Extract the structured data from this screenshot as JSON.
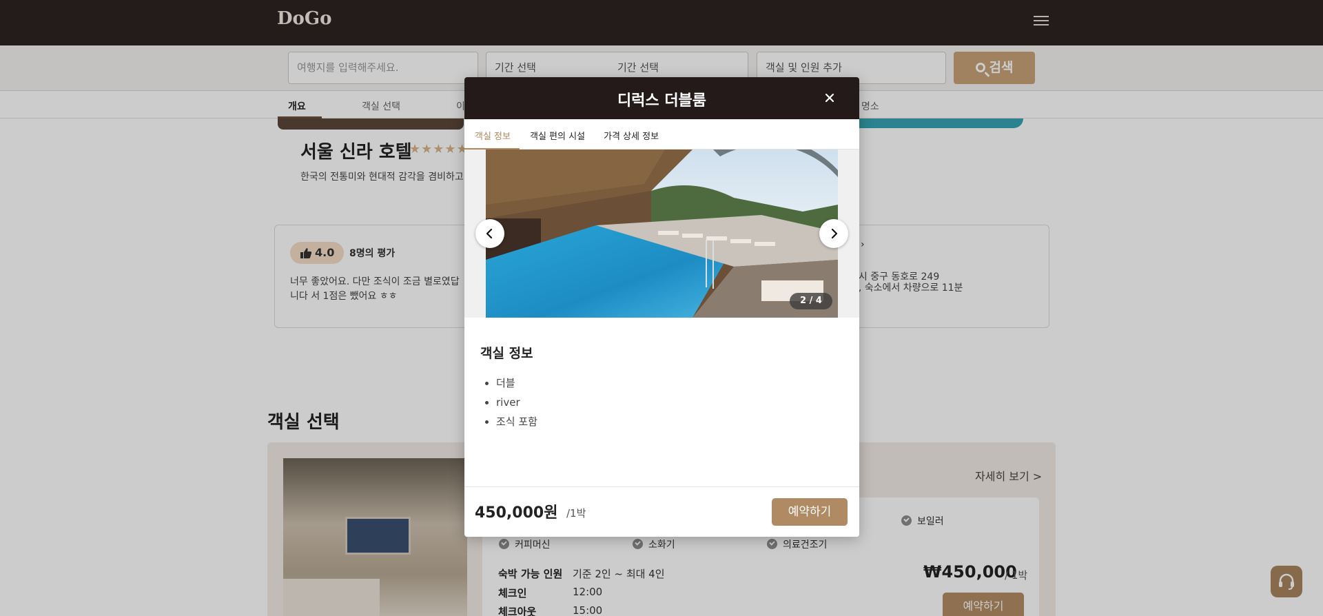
{
  "header": {
    "logo": "DoGo"
  },
  "search": {
    "destination_placeholder": "여행지를 입력해주세요.",
    "start_date": "기간 선택",
    "end_date": "기간 선택",
    "guests": "객실 및 인원 추가",
    "button_label": "검색"
  },
  "page_tabs": [
    {
      "label": "개요",
      "active": true
    },
    {
      "label": "객실 선택",
      "active": false
    },
    {
      "label": "이",
      "active": false
    },
    {
      "label": "명소",
      "active": false
    }
  ],
  "hotel": {
    "name": "서울 신라 호텔",
    "stars": "★★★★★",
    "description": "한국의 전통미와 현대적 감각을 겸비하고"
  },
  "review": {
    "score": "4.0",
    "count_label": "8명의 평가",
    "text": "너무 좋았어요. 다만 조식이 조금 별로였답니다 서 1점은 뺐어요 ㅎㅎ"
  },
  "location": {
    "title_fragment": "›",
    "address_fragment": "별시 중구 동호로 249",
    "distance_fragment": "항, 숙소에서 차량으로 11분"
  },
  "room_section": {
    "title": "객실 선택",
    "detail_link": "자세히 보기 >",
    "amenities": [
      "보일러",
      "커피머신",
      "소화기",
      "의료건조기"
    ],
    "capacity_label": "숙박 가능 인원",
    "capacity_value": "기준 2인 ~ 최대 4인",
    "checkin_label": "체크인",
    "checkin_value": "12:00",
    "checkout_label": "체크아웃",
    "checkout_value": "15:00",
    "price": "₩450,000",
    "price_unit": "/ 1박",
    "book_label": "예약하기"
  },
  "modal": {
    "title": "디럭스 더블룸",
    "close_icon": "close-icon",
    "tabs": [
      {
        "label": "객실 정보",
        "active": true
      },
      {
        "label": "객실 편의 시설",
        "active": false
      },
      {
        "label": "가격 상세 정보",
        "active": false
      }
    ],
    "carousel": {
      "counter": "2 / 4",
      "current": 2,
      "total": 4
    },
    "info_title": "객실 정보",
    "info_items": [
      "더블",
      "river",
      "조식 포함"
    ],
    "price": "450,000원",
    "price_unit": "/1박",
    "book_label": "예약하기"
  },
  "colors": {
    "header_bg": "#2d2322",
    "accent": "#b08a62",
    "modal_header_bg": "#241a1a",
    "tab_active": "#b4875c"
  }
}
